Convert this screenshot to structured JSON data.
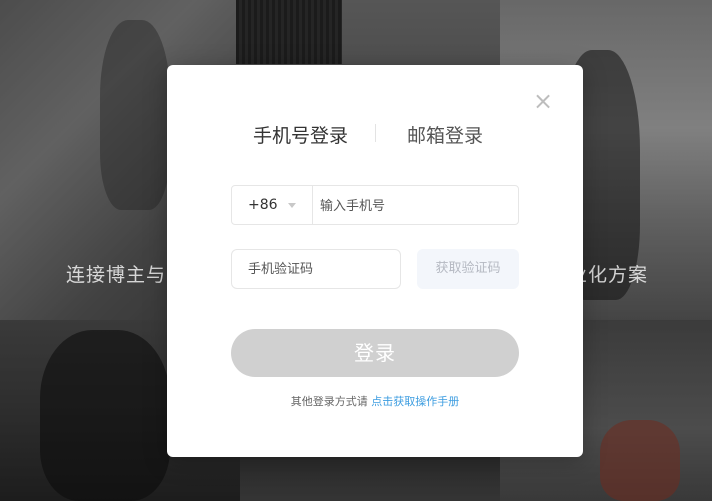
{
  "background": {
    "tagline_left": "连接博主与",
    "tagline_right": "业化方案"
  },
  "modal": {
    "close_icon": "close-icon",
    "tabs": [
      {
        "label": "手机号登录",
        "active": true
      },
      {
        "label": "邮箱登录",
        "active": false
      }
    ],
    "phone": {
      "country_code": "+86",
      "placeholder": "输入手机号",
      "value": ""
    },
    "verify": {
      "placeholder": "手机验证码",
      "value": "",
      "get_code_label": "获取验证码"
    },
    "login_label": "登录",
    "other_text": "其他登录方式请",
    "other_link": "点击获取操作手册"
  },
  "colors": {
    "link": "#3d9de0",
    "login_button_disabled": "#d0d0d0",
    "get_code_bg": "#f3f6fb"
  }
}
